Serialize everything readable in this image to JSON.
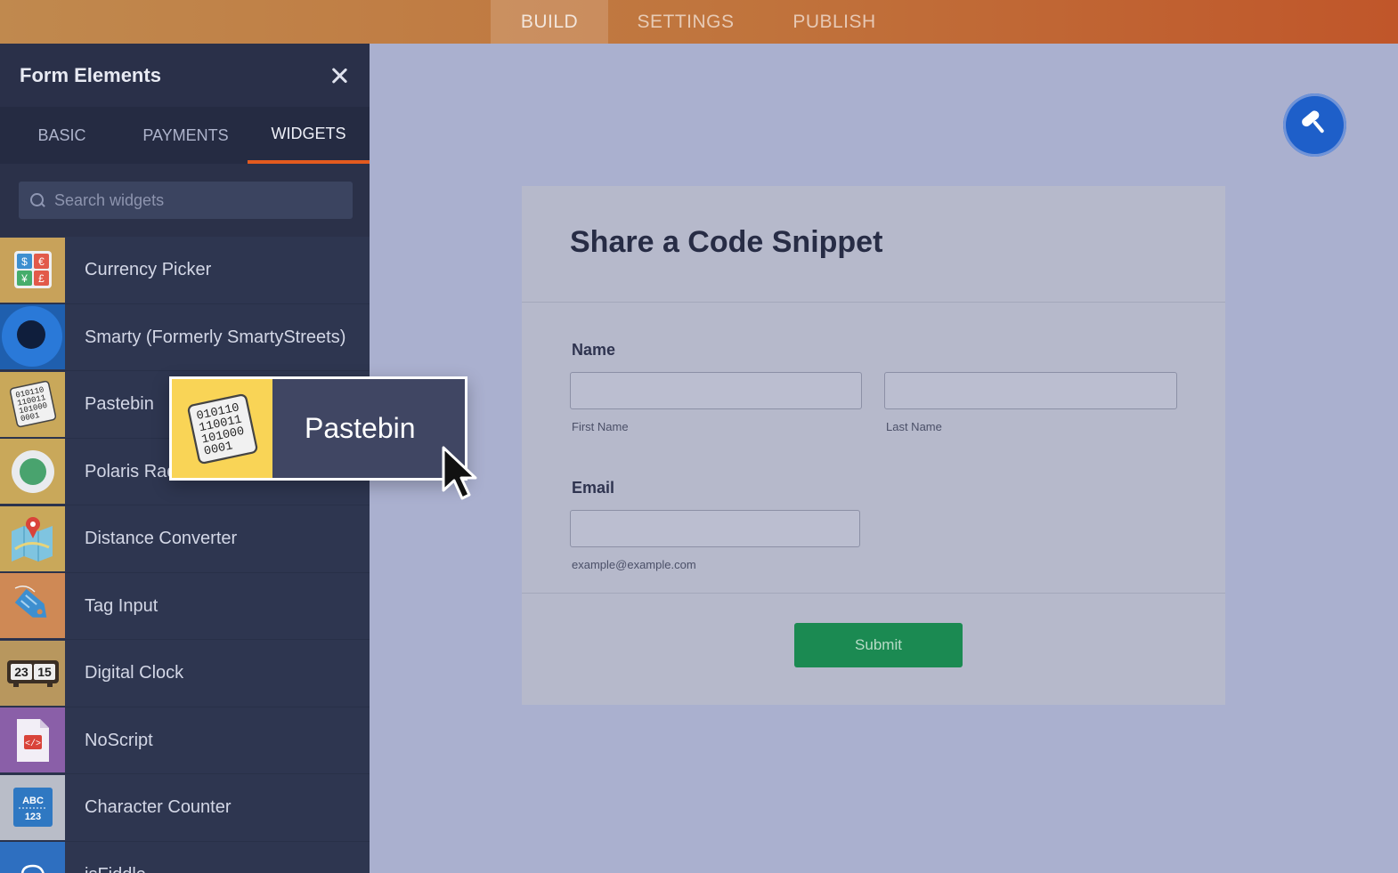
{
  "topnav": {
    "tabs": [
      {
        "label": "BUILD",
        "active": true
      },
      {
        "label": "SETTINGS",
        "active": false
      },
      {
        "label": "PUBLISH",
        "active": false
      }
    ]
  },
  "sidebar": {
    "title": "Form Elements",
    "tabs": [
      {
        "label": "BASIC",
        "active": false
      },
      {
        "label": "PAYMENTS",
        "active": false
      },
      {
        "label": "WIDGETS",
        "active": true
      }
    ],
    "search": {
      "placeholder": "Search widgets",
      "value": ""
    },
    "widgets": [
      {
        "label": "Currency Picker",
        "icon": "currency-picker-icon"
      },
      {
        "label": "Smarty (Formerly SmartyStreets)",
        "icon": "smarty-icon"
      },
      {
        "label": "Pastebin",
        "icon": "binary-code-icon"
      },
      {
        "label": "Polaris Radio",
        "icon": "radio-button-icon"
      },
      {
        "label": "Distance Converter",
        "icon": "map-pin-icon"
      },
      {
        "label": "Tag Input",
        "icon": "tag-icon"
      },
      {
        "label": "Digital Clock",
        "icon": "digital-clock-icon"
      },
      {
        "label": "NoScript",
        "icon": "code-file-icon"
      },
      {
        "label": "Character Counter",
        "icon": "abc-123-icon"
      },
      {
        "label": "jsFiddle",
        "icon": "cloud-icon"
      }
    ]
  },
  "form": {
    "title": "Share a Code Snippet",
    "name_label": "Name",
    "first_name_sublabel": "First Name",
    "last_name_sublabel": "Last Name",
    "email_label": "Email",
    "email_sublabel": "example@example.com",
    "submit_label": "Submit"
  },
  "drag_ghost": {
    "label": "Pastebin",
    "icon": "binary-code-icon"
  },
  "colors": {
    "accent": "#e35a1f",
    "submit": "#1b8a52",
    "paint_button": "#1e5fc9"
  }
}
